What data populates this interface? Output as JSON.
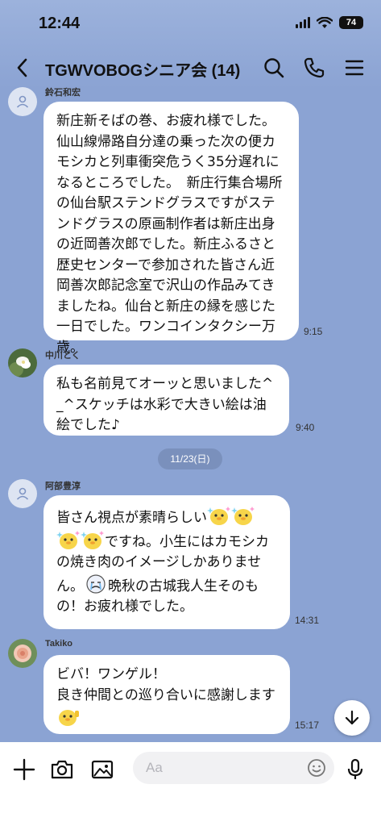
{
  "status": {
    "time": "12:44",
    "battery": "74"
  },
  "header": {
    "title": "TGWVOBOGシニア会 (14)"
  },
  "messages": [
    {
      "sender": "鈴石和宏",
      "text": "新庄新そばの巻、お疲れ様でした。仙山線帰路自分達の乗った次の便カモシカと列車衝突危うく35分遅れになるところでした。　新庄行集合場所の仙台駅ステンドグラスですがステンドグラスの原画制作者は新庄出身の近岡善次郎でした。新庄ふるさと歴史センターで参加された皆さん近岡善次郎記念室で沢山の作品みてきましたね。仙台と新庄の縁を感じた一日でした。ワンコインタクシー万歳。",
      "time": "9:15"
    },
    {
      "sender": "中川とく",
      "text": "私も名前見てオーッと思いました^_^スケッチは水彩で大きい絵は油絵でした♪",
      "time": "9:40"
    },
    {
      "sender": "阿部豊淳",
      "text_a": "皆さん視点が素晴らしい",
      "text_b": "ですね。小生にはカモシカの焼き肉のイメージしかありません。",
      "text_c": "晩秋の古城我人生そのもの！お疲れ様でした。",
      "time": "14:31"
    },
    {
      "sender": "Takiko",
      "text_a": "ビバ！ワンゲル！\n良き仲間との巡り合いに感謝します",
      "time": "15:17"
    }
  ],
  "date_separator": "11/23(日)",
  "input": {
    "placeholder": "Aa"
  },
  "icons": {
    "back": "chevron-left-icon",
    "search": "search-icon",
    "call": "phone-icon",
    "menu": "menu-icon",
    "add": "plus-icon",
    "camera": "camera-icon",
    "image": "image-icon",
    "emoji": "smile-icon",
    "mic": "mic-icon",
    "scroll": "arrow-down-icon"
  },
  "colors": {
    "chat_bg": "#8ba3d3",
    "bubble": "#ffffff"
  }
}
